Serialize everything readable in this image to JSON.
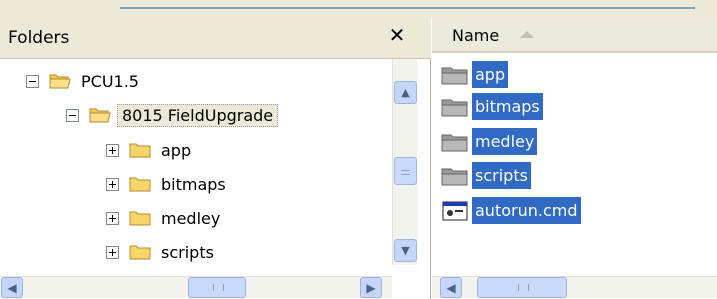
{
  "folders_pane": {
    "title": "Folders",
    "close_glyph": "✕",
    "tree": [
      {
        "label": "PCU1.5",
        "expander": "minus",
        "level": 0,
        "selected": false
      },
      {
        "label": "8015 FieldUpgrade",
        "expander": "minus",
        "level": 1,
        "selected": true
      },
      {
        "label": "app",
        "expander": "plus",
        "level": 2,
        "selected": false
      },
      {
        "label": "bitmaps",
        "expander": "plus",
        "level": 2,
        "selected": false
      },
      {
        "label": "medley",
        "expander": "plus",
        "level": 2,
        "selected": false
      },
      {
        "label": "scripts",
        "expander": "plus",
        "level": 2,
        "selected": false
      }
    ]
  },
  "files_pane": {
    "column_name": "Name",
    "sort_icon": "sort-ascending-icon",
    "items": [
      {
        "label": "app",
        "icon": "folder-icon"
      },
      {
        "label": "bitmaps",
        "icon": "folder-icon"
      },
      {
        "label": "medley",
        "icon": "folder-icon"
      },
      {
        "label": "scripts",
        "icon": "folder-icon"
      },
      {
        "label": "autorun.cmd",
        "icon": "cmd-file-icon"
      }
    ]
  },
  "colors": {
    "selection": "#316ac5",
    "header_bg": "#ece9d8",
    "scrollbar": "#c4d7fa"
  }
}
